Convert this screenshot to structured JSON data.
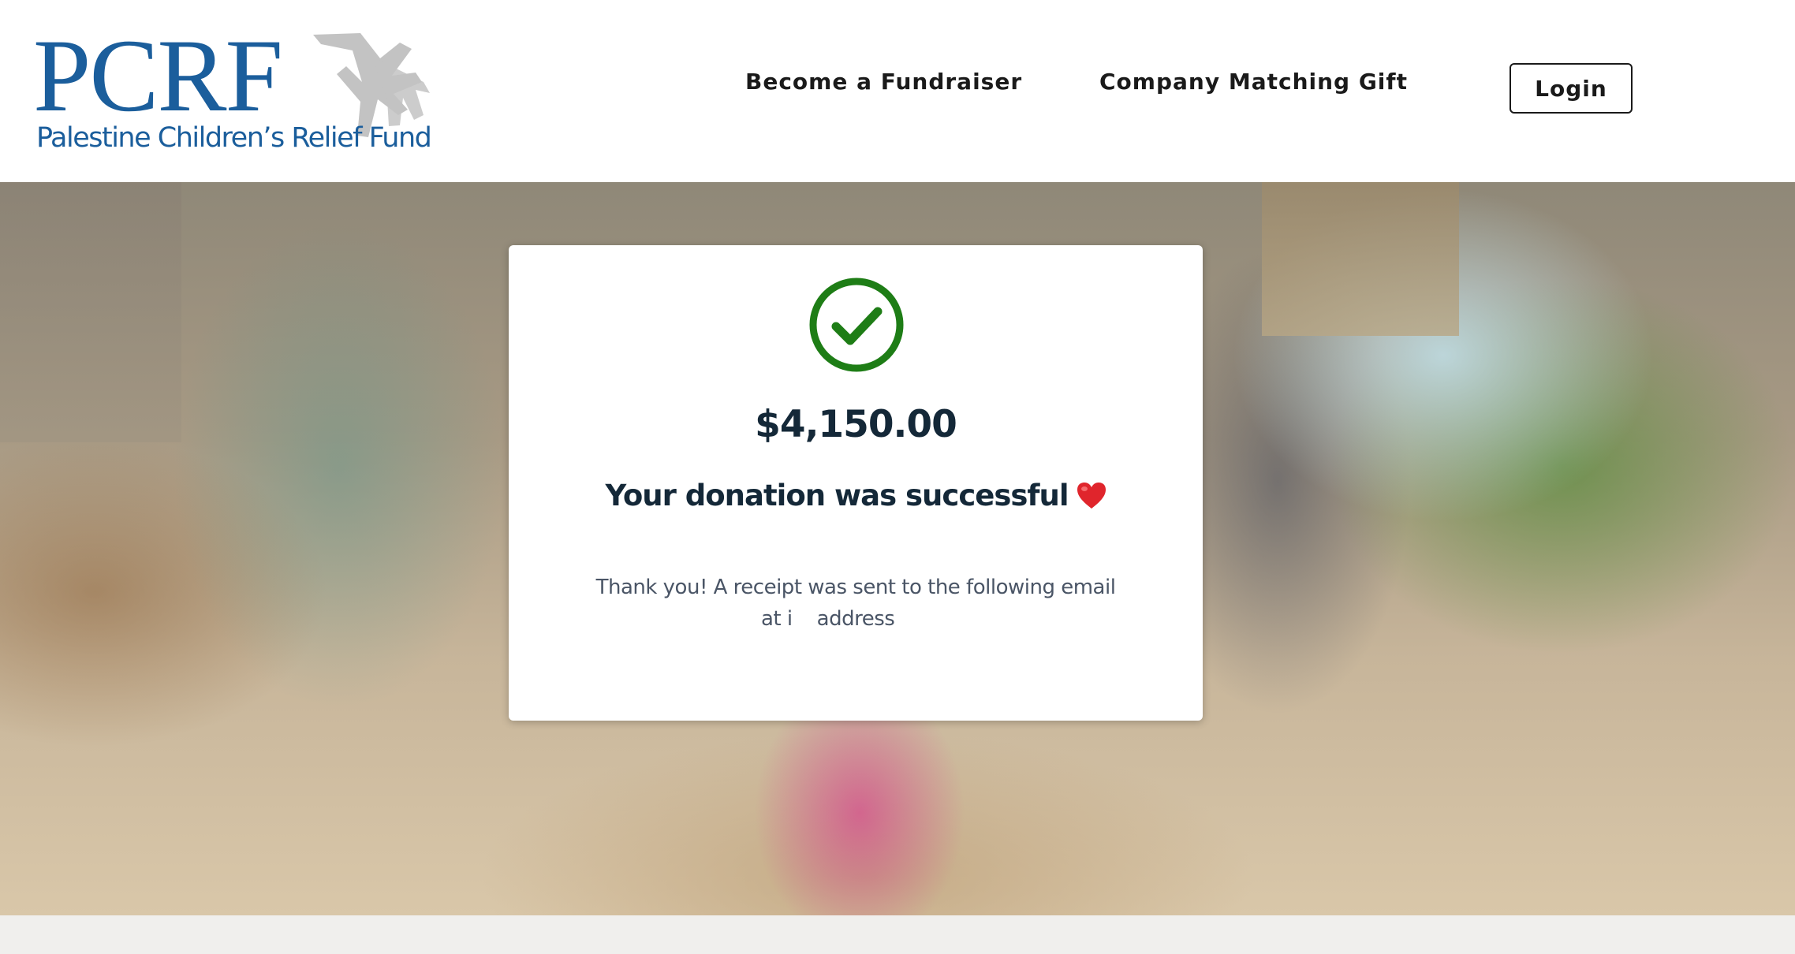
{
  "header": {
    "logo_word": "PCRF",
    "logo_subtitle": "Palestine Children’s Relief Fund",
    "logo_icon": "hands-icon",
    "nav": {
      "fundraiser": "Become a Fundraiser",
      "matching_gift": "Company Matching Gift"
    },
    "login_label": "Login"
  },
  "card": {
    "status_icon": "check-circle-icon",
    "amount": "$4,150.00",
    "success_message": "Your donation was successful",
    "success_emoji": "heart-icon",
    "thank_you": "Thank you! A receipt was sent to the following email address",
    "email_prefix": "at i"
  },
  "colors": {
    "brand_blue": "#1b5e9c",
    "success_green": "#1e7d16",
    "heading_navy": "#142838",
    "body_gray": "#4a5566",
    "heart_red": "#e0252c"
  }
}
